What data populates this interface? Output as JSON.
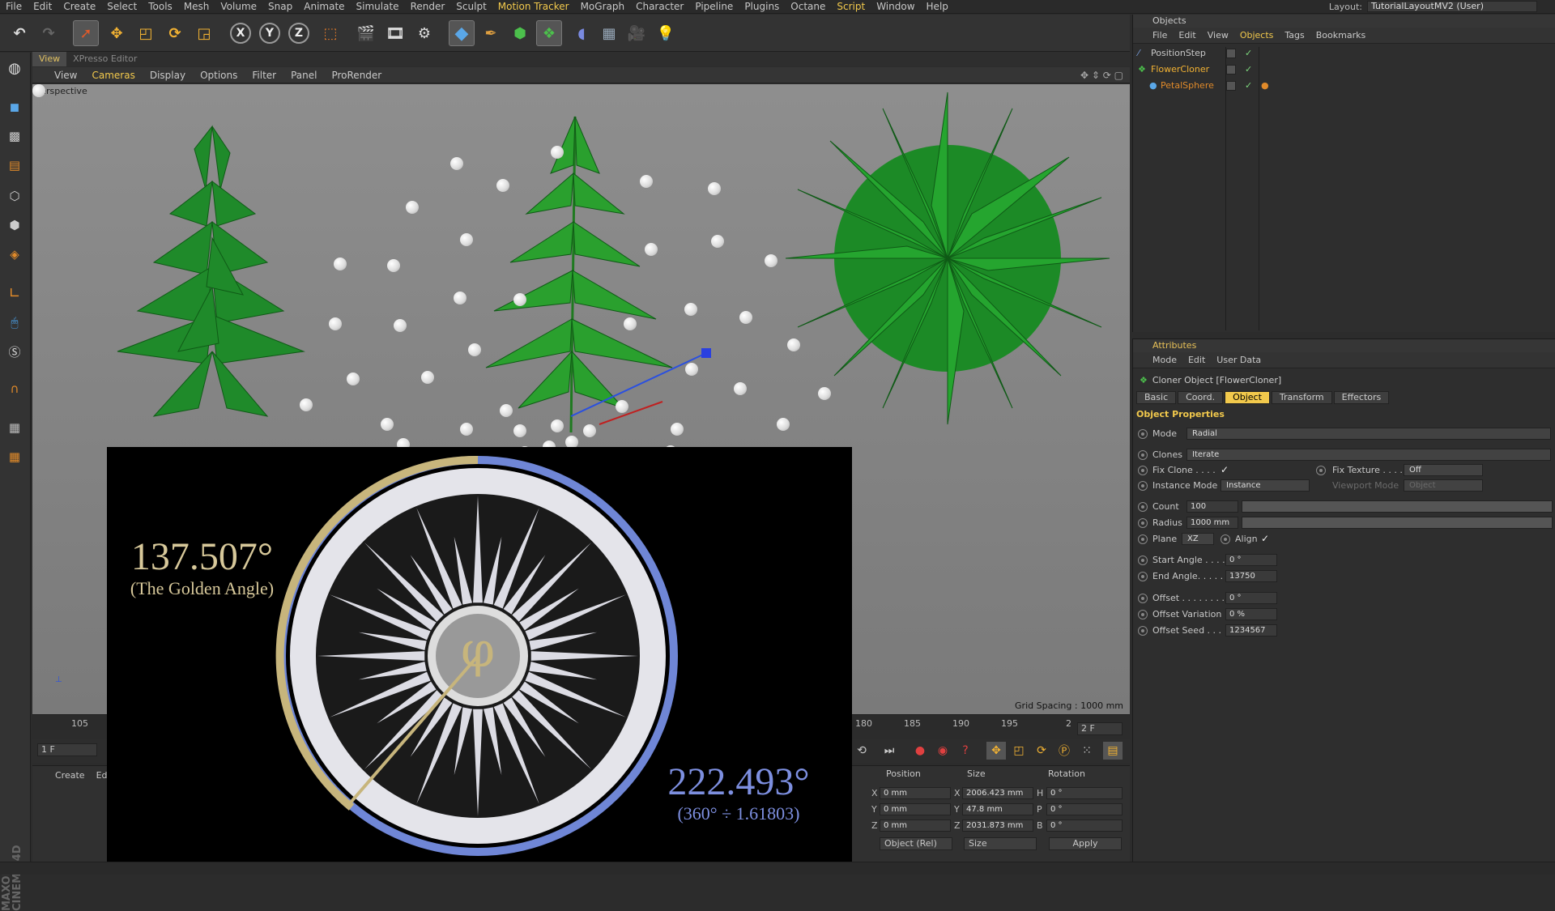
{
  "menubar": {
    "items": [
      "File",
      "Edit",
      "Create",
      "Select",
      "Tools",
      "Mesh",
      "Volume",
      "Snap",
      "Animate",
      "Simulate",
      "Render",
      "Sculpt",
      "Motion Tracker",
      "MoGraph",
      "Character",
      "Pipeline",
      "Plugins",
      "Octane",
      "Script",
      "Window",
      "Help"
    ],
    "highlighted": [
      "Motion Tracker",
      "Script"
    ],
    "layout_label": "Layout:",
    "layout_value": "TutorialLayoutMV2 (User)"
  },
  "toolbar": {
    "icons": [
      "undo-icon",
      "redo-icon",
      "select-arrow-icon",
      "move-icon",
      "scale-icon",
      "rotate-icon",
      "recent-tool-icon",
      "x-axis-lock-icon",
      "y-axis-lock-icon",
      "z-axis-lock-icon",
      "coordinate-system-icon",
      "render-view-icon",
      "render-picture-viewer-icon",
      "render-settings-icon",
      "cube-icon",
      "pen-icon",
      "subdivision-icon",
      "array-icon",
      "deformer-icon",
      "floor-icon",
      "camera-icon",
      "light-icon"
    ],
    "axes": [
      "X",
      "Y",
      "Z"
    ]
  },
  "view": {
    "tabs": [
      "View",
      "XPresso Editor"
    ],
    "menu": [
      "View",
      "Cameras",
      "Display",
      "Options",
      "Filter",
      "Panel",
      "ProRender"
    ],
    "highlighted": [
      "Cameras"
    ],
    "camera": "Perspective",
    "grid_spacing": "Grid Spacing : 1000 mm"
  },
  "overlay": {
    "golden_angle": "137.507°",
    "golden_angle_caption": "(The Golden Angle)",
    "other_angle": "222.493°",
    "other_angle_caption": "(360° ÷ 1.61803)",
    "phi_symbol": "φ"
  },
  "timeline": {
    "ticks": [
      "105",
      "180",
      "185",
      "190",
      "195",
      "2"
    ],
    "current_frame": "1 F",
    "end_frame": "2 F"
  },
  "material_manager": {
    "menu": [
      "Create",
      "Edit"
    ]
  },
  "coordinates": {
    "headers": [
      "Position",
      "Size",
      "Rotation"
    ],
    "rows": [
      {
        "axis": "X",
        "pos": "0 mm",
        "saxis": "X",
        "size": "2006.423 mm",
        "raxis": "H",
        "rot": "0 °"
      },
      {
        "axis": "Y",
        "pos": "0 mm",
        "saxis": "Y",
        "size": "47.8 mm",
        "raxis": "P",
        "rot": "0 °"
      },
      {
        "axis": "Z",
        "pos": "0 mm",
        "saxis": "Z",
        "size": "2031.873 mm",
        "raxis": "B",
        "rot": "0 °"
      }
    ],
    "mode": "Object (Rel)",
    "size_mode": "Size",
    "apply": "Apply"
  },
  "objects_panel": {
    "title": "Objects",
    "menu": [
      "File",
      "Edit",
      "View",
      "Objects",
      "Tags",
      "Bookmarks"
    ],
    "highlighted": "Objects",
    "items": [
      {
        "name": "PositionStep",
        "color": "#c8c8c8"
      },
      {
        "name": "FlowerCloner",
        "color": "#f2b233"
      },
      {
        "name": "PetalSphere",
        "color": "#e08a2a"
      }
    ]
  },
  "attributes": {
    "title": "Attributes",
    "menu": [
      "Mode",
      "Edit",
      "User Data"
    ],
    "object_name": "Cloner Object [FlowerCloner]",
    "tabs": [
      "Basic",
      "Coord.",
      "Object",
      "Transform",
      "Effectors"
    ],
    "active_tab": "Object",
    "section": "Object Properties",
    "mode_label": "Mode",
    "mode_value": "Radial",
    "clones_label": "Clones",
    "clones_value": "Iterate",
    "fix_clone_label": "Fix Clone . . . .",
    "fix_texture_label": "Fix Texture . . . .",
    "fix_texture_value": "Off",
    "instance_mode_label": "Instance Mode",
    "instance_mode_value": "Instance",
    "viewport_mode_label": "Viewport Mode",
    "viewport_mode_value": "Object",
    "count_label": "Count",
    "count_value": "100",
    "radius_label": "Radius",
    "radius_value": "1000 mm",
    "plane_label": "Plane",
    "plane_value": "XZ",
    "align_label": "Align",
    "start_angle_label": "Start Angle . . . .",
    "start_angle_value": "0 °",
    "end_angle_label": "End Angle. . . . .",
    "end_angle_value": "13750",
    "offset_label": "Offset . . . . . . . .",
    "offset_value": "0 °",
    "offset_var_label": "Offset Variation",
    "offset_var_value": "0 %",
    "offset_seed_label": "Offset Seed . . .",
    "offset_seed_value": "1234567"
  },
  "colors": {
    "accent": "#f2c94c",
    "leaf": "#1f8a2a",
    "gold": "#d7c89a",
    "blue": "#7d8fe0"
  }
}
